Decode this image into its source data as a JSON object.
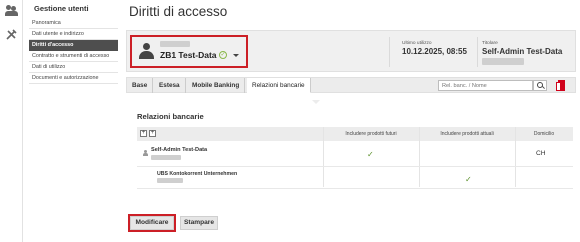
{
  "sidebar": {
    "title": "Gestione utenti",
    "items": [
      {
        "label": "Panoramica",
        "active": false
      },
      {
        "label": "Dati utente e indirizzo",
        "active": false
      },
      {
        "label": "Diritti d'accesso",
        "active": true
      },
      {
        "label": "Contratto e strumenti di accesso",
        "active": false
      },
      {
        "label": "Dati di utilizzo",
        "active": false
      },
      {
        "label": "Documenti e autorizzazione",
        "active": false
      }
    ]
  },
  "page": {
    "title": "Diritti di accesso"
  },
  "user": {
    "name": "ZB1 Test-Data",
    "last_use_label": "Ultimo utilizzo",
    "last_use_value": "10.12.2025, 08:55",
    "owner_label": "Titolare",
    "owner_value": "Self-Admin Test-Data"
  },
  "tabs": [
    {
      "label": "Base",
      "active": false
    },
    {
      "label": "Estesa",
      "active": false
    },
    {
      "label": "Mobile Banking",
      "active": false
    },
    {
      "label": "Relazioni bancarie",
      "active": true
    }
  ],
  "search": {
    "placeholder": "Rel. banc. / Nome"
  },
  "section": {
    "title": "Relazioni bancarie"
  },
  "table": {
    "headers": {
      "future": "Includere prodotti futuri",
      "current": "Includere prodotti attuali",
      "domicile": "Domicilio"
    },
    "rows": [
      {
        "name": "Self-Admin Test-Data",
        "future_included": true,
        "current_included": false,
        "domicile": "CH"
      },
      {
        "name": "UBS Kontokorrent Unternehmen",
        "future_included": false,
        "current_included": true,
        "domicile": ""
      }
    ],
    "check_glyph": "✓"
  },
  "buttons": {
    "edit": "Modificare",
    "print": "Stampare"
  },
  "colors": {
    "accent_red": "#cc1f26",
    "active_nav": "#4e4e4e",
    "check_green": "#5a8f29"
  }
}
